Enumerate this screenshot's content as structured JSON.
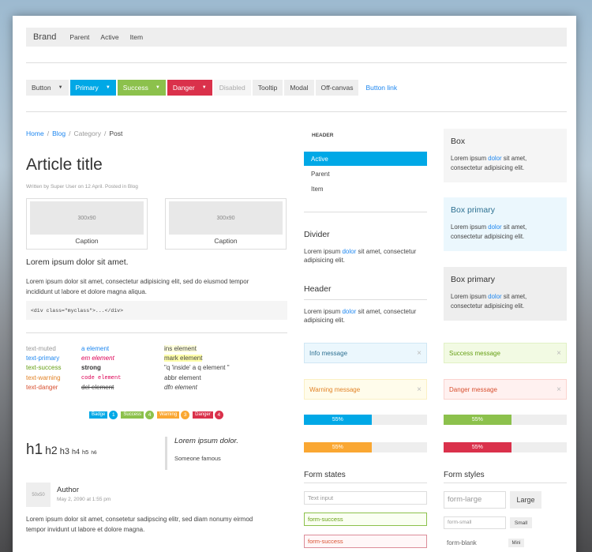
{
  "navbar": {
    "brand": "Brand",
    "items": [
      "Parent",
      "Active",
      "Item"
    ]
  },
  "buttons": {
    "button": "Button",
    "primary": "Primary",
    "success": "Success",
    "danger": "Danger",
    "disabled": "Disabled",
    "tooltip": "Tooltip",
    "modal": "Modal",
    "offcanvas": "Off-canvas",
    "link": "Button link"
  },
  "breadcrumb": [
    "Home",
    "Blog",
    "Category",
    "Post"
  ],
  "article": {
    "title": "Article title",
    "meta": "Written by Super User on 12 April. Posted in Blog",
    "thumbs": [
      {
        "placeholder": "300x90",
        "caption": "Caption"
      },
      {
        "placeholder": "300x90",
        "caption": "Caption"
      }
    ],
    "lead": "Lorem ipsum dolor sit amet.",
    "para_line1": "Lorem ipsum dolor sit amet, consectetur adipisicing elit, sed do eiusmod tempor",
    "para_line2": "incididunt ut labore et dolore magna aliqua.",
    "code": "<div class=\"myclass\">...</div>"
  },
  "text_styles": {
    "col1": [
      "text-muted",
      "text-primary",
      "text-success",
      "text-warning",
      "text-danger"
    ],
    "col2": [
      "a element",
      "em element",
      "strong",
      "code element",
      "del element"
    ],
    "col3": [
      "ins element",
      "mark element",
      "\"q 'inside' a q element \"",
      "abbr element",
      "dfn element"
    ]
  },
  "badges": {
    "badge": "Badge",
    "badge_num": "1",
    "success": "Success",
    "success_num": "4",
    "warning": "Warning",
    "warning_num": "3",
    "danger": "Danger",
    "danger_num": "4"
  },
  "headings": [
    "h1",
    "h2",
    "h3",
    "h4",
    "h5",
    "h6"
  ],
  "quote": {
    "text": "Lorem ipsum dolor.",
    "author": "Someone famous"
  },
  "comment": {
    "avatar": "50x50",
    "author": "Author",
    "date": "May 2, 2090 at 1:55 pm",
    "line1": "Lorem ipsum dolor sit amet, consetetur sadipscing elitr, sed diam nonumy eirmod",
    "line2": "tempor invidunt ut labore et dolore magna."
  },
  "sidenav": {
    "header": "HEADER",
    "items": [
      "Active",
      "Parent",
      "Item"
    ]
  },
  "panels": {
    "divider_title": "Divider",
    "header_title": "Header",
    "text_a": "Lorem ipsum",
    "text_link": "dolor",
    "text_b": "sit amet, consectetur",
    "text_c": "adipisicing elit."
  },
  "alerts": {
    "info": "Info message",
    "warning": "Warning message",
    "success": "Success message",
    "danger": "Danger message",
    "close": "×"
  },
  "progress": {
    "label": "55%",
    "value": 55
  },
  "form_states": {
    "title": "Form states",
    "text_input": "Text input",
    "success": "form-success",
    "danger": "form-success"
  },
  "form_styles": {
    "title": "Form styles",
    "large": "form-large",
    "large_btn": "Large",
    "small": "form-small",
    "small_btn": "Small",
    "blank": "form-blank",
    "mini_btn": "Mini"
  },
  "boxes": {
    "box_title": "Box",
    "primary_title": "Box primary",
    "dark_title": "Box primary",
    "text_a": "Lorem ipsum",
    "text_link": "dolor",
    "text_b": "sit amet,",
    "text_c": "consectetur adipisicing elit."
  },
  "colors": {
    "primary": "#00a8e6",
    "success": "#8cc14c",
    "warning": "#faa732",
    "danger": "#da314b",
    "link": "#1e87f0"
  }
}
